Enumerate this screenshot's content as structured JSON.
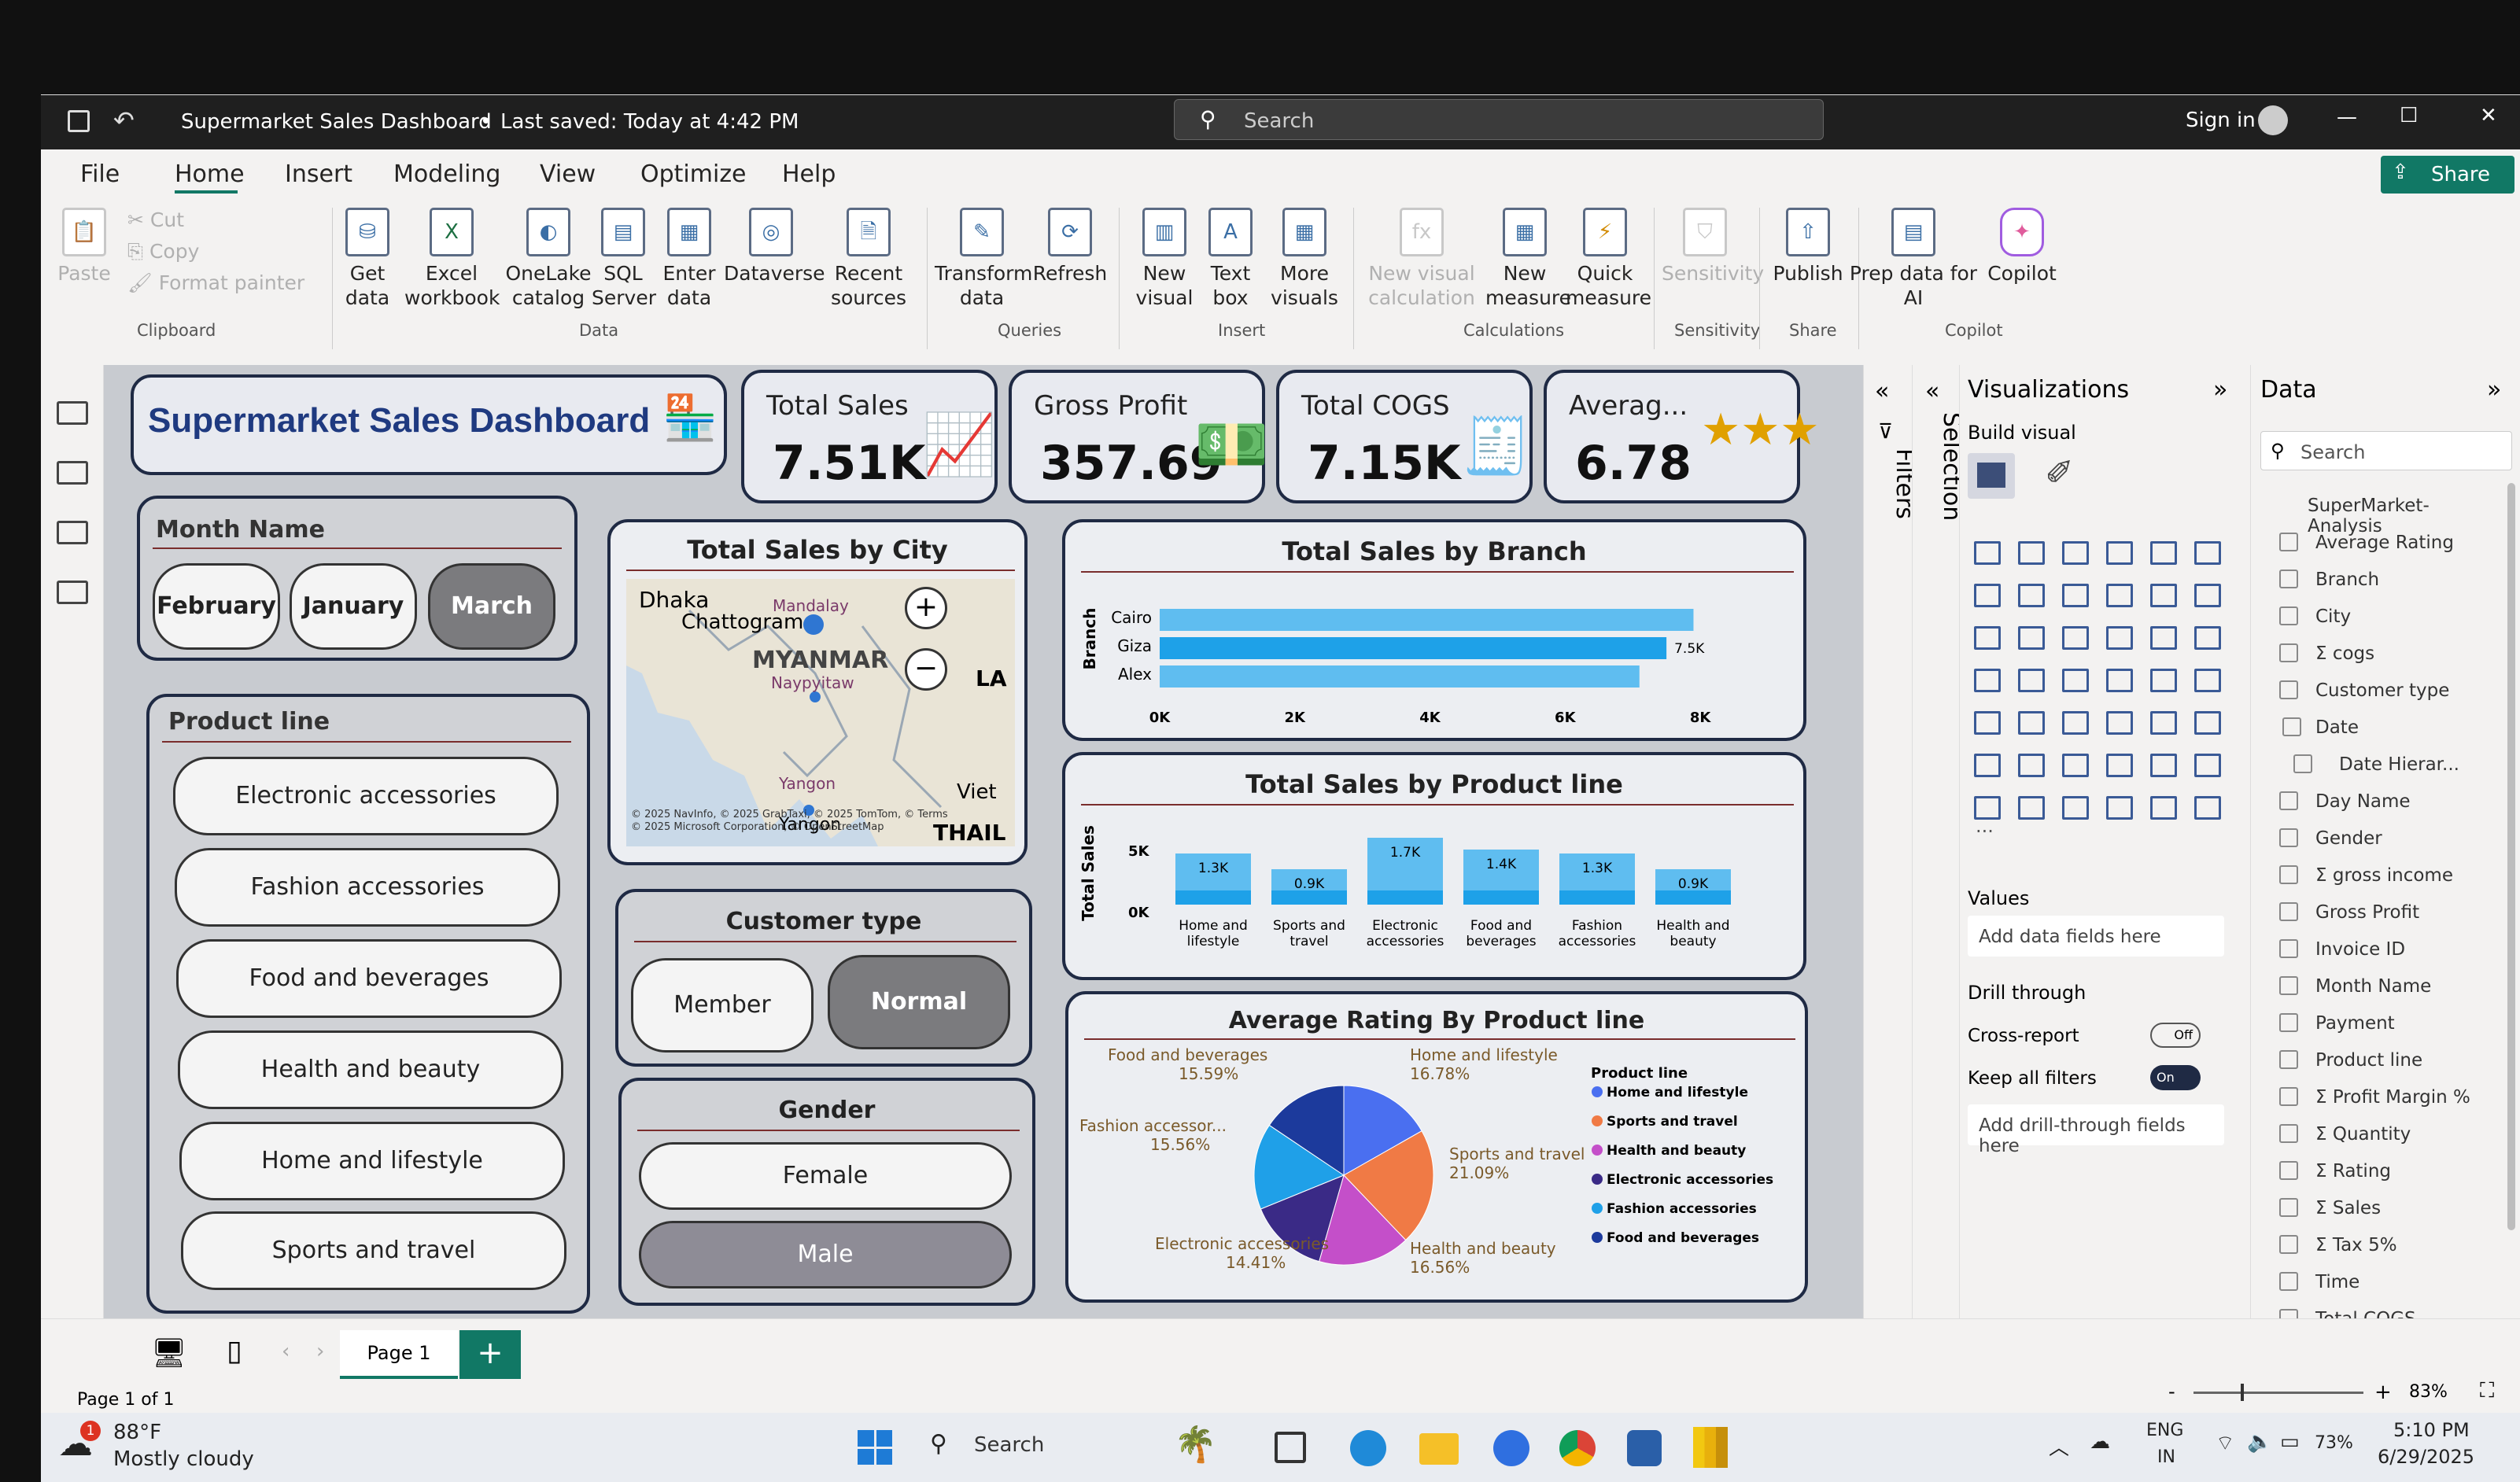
{
  "titlebar": {
    "title": "Supermarket Sales Dashboard",
    "saved": "Last saved: Today at 4:42 PM",
    "search": "Search",
    "signin": "Sign in"
  },
  "menu": {
    "items": [
      "File",
      "Home",
      "Insert",
      "Modeling",
      "View",
      "Optimize",
      "Help"
    ],
    "share": "Share"
  },
  "ribbon": {
    "clipboard": {
      "paste": "Paste",
      "cut": "Cut",
      "copy": "Copy",
      "format": "Format painter",
      "group": "Clipboard"
    },
    "data": {
      "get": "Get data",
      "excel": "Excel workbook",
      "onelake": "OneLake catalog",
      "sql": "SQL Server",
      "enter": "Enter data",
      "dataverse": "Dataverse",
      "recent": "Recent sources",
      "group": "Data"
    },
    "queries": {
      "transform": "Transform data",
      "refresh": "Refresh",
      "group": "Queries"
    },
    "insert": {
      "newvisual": "New visual",
      "textbox": "Text box",
      "more": "More visuals",
      "group": "Insert"
    },
    "calc": {
      "newcalc": "New visual calculation",
      "newmeasure": "New measure",
      "quick": "Quick measure",
      "group": "Calculations"
    },
    "sens": {
      "label": "Sensitivity",
      "group": "Sensitivity"
    },
    "share": {
      "publish": "Publish",
      "group": "Share"
    },
    "copilot": {
      "prep": "Prep data for AI",
      "copilot": "Copilot",
      "group": "Copilot"
    }
  },
  "dashboard": {
    "title": "Supermarket Sales Dashboard",
    "kpis": [
      {
        "label": "Total Sales",
        "value": "7.51K"
      },
      {
        "label": "Gross Profit",
        "value": "357.69"
      },
      {
        "label": "Total COGS",
        "value": "7.15K"
      },
      {
        "label": "Averag...",
        "value": "6.78"
      }
    ],
    "month": {
      "title": "Month Name",
      "items": [
        "February",
        "January",
        "March"
      ],
      "selected": "March"
    },
    "product": {
      "title": "Product line",
      "items": [
        "Electronic accessories",
        "Fashion accessories",
        "Food and beverages",
        "Health and beauty",
        "Home and lifestyle",
        "Sports and travel"
      ]
    },
    "customer": {
      "title": "Customer type",
      "items": [
        "Member",
        "Normal"
      ],
      "selected": "Normal"
    },
    "gender": {
      "title": "Gender",
      "items": [
        "Female",
        "Male"
      ],
      "selected": "Male"
    },
    "map": {
      "title": "Total Sales by City",
      "labels": [
        "Dhaka",
        "Chattogram",
        "Mandalay",
        "MYANMAR",
        "Naypyitaw",
        "Yangon",
        "Yangon",
        "LA",
        "Viet",
        "THAIL"
      ],
      "credit": "© 2025 NavInfo, © 2025 GrabTaxi, © 2025 TomTom, © Terms",
      "credit2": "© 2025 Microsoft Corporation, © OpenStreetMap"
    }
  },
  "chart_data": [
    {
      "type": "bar",
      "orientation": "horizontal",
      "title": "Total Sales by Branch",
      "ylabel": "Branch",
      "categories": [
        "Cairo",
        "Giza",
        "Alex"
      ],
      "values": [
        7.9,
        7.5,
        7.1
      ],
      "data_labels": [
        "",
        "7.5K",
        ""
      ],
      "xticks": [
        "0K",
        "2K",
        "4K",
        "6K",
        "8K"
      ],
      "xlim": [
        0,
        8.5
      ]
    },
    {
      "type": "bar",
      "title": "Total Sales by Product line",
      "ylabel": "Total Sales",
      "categories": [
        "Home and lifestyle",
        "Sports and travel",
        "Electronic accessories",
        "Food and beverages",
        "Fashion accessories",
        "Health and beauty"
      ],
      "values": [
        1.3,
        0.9,
        1.7,
        1.4,
        1.3,
        0.9
      ],
      "data_labels": [
        "1.3K",
        "0.9K",
        "1.7K",
        "1.4K",
        "1.3K",
        "0.9K"
      ],
      "yticks": [
        "5K",
        "0K"
      ]
    },
    {
      "type": "pie",
      "title": "Average Rating By Product line",
      "legend_title": "Product line",
      "categories": [
        "Home and lifestyle",
        "Sports and travel",
        "Health and beauty",
        "Electronic accessories",
        "Fashion accessories",
        "Food and beverages"
      ],
      "values": [
        16.78,
        21.09,
        16.56,
        14.41,
        15.56,
        15.59
      ],
      "labels": [
        "16.78%",
        "21.09%",
        "16.56%",
        "14.41%",
        "15.56%",
        "15.59%"
      ],
      "label_names": [
        "Home and lifestyle",
        "Sports and travel",
        "Health and beauty",
        "Electronic accessories",
        "Fashion accessor...",
        "Food and beverages"
      ],
      "colors": [
        "#4a6ff0",
        "#f07a45",
        "#c44fc9",
        "#3a2a86",
        "#1fa0e8",
        "#1c3a9c"
      ]
    }
  ],
  "filters": {
    "label": "Filters"
  },
  "selection": {
    "label": "Selection"
  },
  "viz": {
    "title": "Visualizations",
    "build": "Build visual",
    "values": "Values",
    "add": "Add data fields here",
    "drill": "Drill through",
    "cross": "Cross-report",
    "cross_state": "Off",
    "keep": "Keep all filters",
    "keep_state": "On",
    "adddrill": "Add drill-through fields here",
    "dots": "..."
  },
  "data": {
    "title": "Data",
    "search": "Search",
    "fields": [
      "SuperMarket-Analysis",
      "Average Rating",
      "Branch",
      "City",
      "Σ cogs",
      "Customer type",
      "Date",
      "Date Hierar...",
      "Day Name",
      "Gender",
      "Σ gross income",
      "Gross Profit",
      "Invoice ID",
      "Month Name",
      "Payment",
      "Product line",
      "Σ Profit Margin %",
      "Σ Quantity",
      "Σ Rating",
      "Σ Sales",
      "Σ Tax 5%",
      "Time",
      "Total COGS"
    ]
  },
  "pages": {
    "page": "Page 1",
    "status": "Page 1 of 1",
    "zoom": "83%",
    "add": "+"
  },
  "taskbar": {
    "temp": "88°F",
    "weather": "Mostly cloudy",
    "search": "Search",
    "lang1": "ENG",
    "lang2": "IN",
    "battery": "73%",
    "time": "5:10 PM",
    "date": "6/29/2025",
    "badge": "1"
  }
}
